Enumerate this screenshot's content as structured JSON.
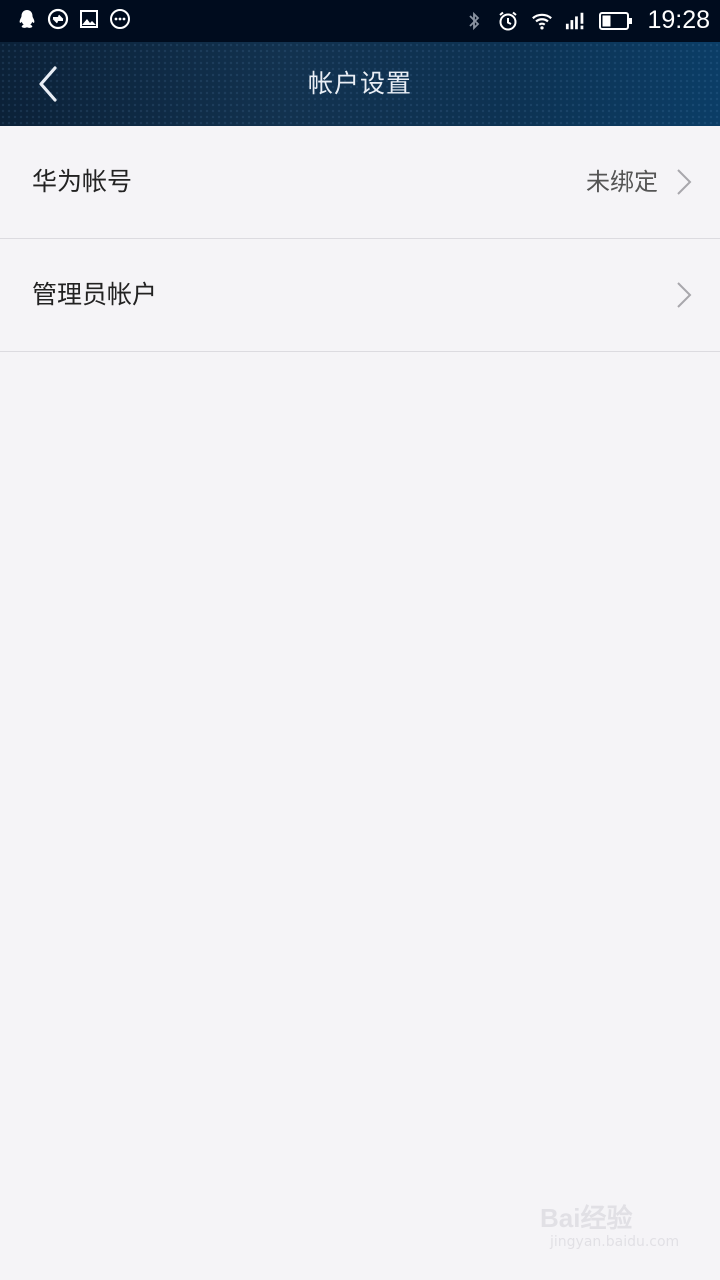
{
  "status_bar": {
    "time": "19:28",
    "left_icons": [
      "qq-icon",
      "sync-icon",
      "image-icon",
      "more-dots-icon"
    ],
    "right_icons": [
      "bluetooth-icon",
      "alarm-icon",
      "wifi-icon",
      "signal-icon",
      "battery-icon"
    ],
    "battery_level": 0.35
  },
  "header": {
    "title": "帐户设置",
    "back_icon": "chevron-left-icon"
  },
  "list": {
    "items": [
      {
        "label": "华为帐号",
        "value": "未绑定",
        "chevron": "chevron-right-icon"
      },
      {
        "label": "管理员帐户",
        "value": "",
        "chevron": "chevron-right-icon"
      }
    ]
  },
  "watermark": {
    "text": "Bai经验",
    "sub": "jingyan.baidu.com"
  },
  "colors": {
    "status_bar_bg": "#000c1e",
    "header_bg": "#0d3252",
    "page_bg": "#f5f4f7",
    "divider": "#dcdbe0"
  }
}
